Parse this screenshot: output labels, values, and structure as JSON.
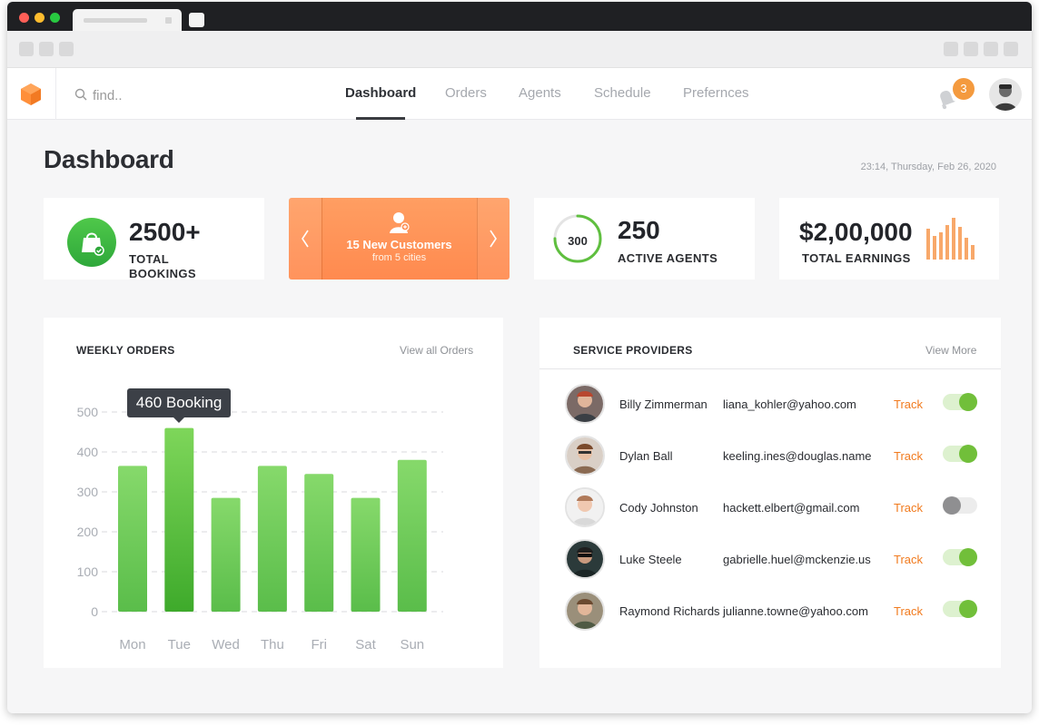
{
  "nav": {
    "search_placeholder": "find..",
    "links": [
      "Dashboard",
      "Orders",
      "Agents",
      "Schedule",
      "Prefernces"
    ],
    "active_index": 0,
    "notification_count": "3"
  },
  "page": {
    "title": "Dashboard",
    "datetime": "23:14, Thursday, Feb 26, 2020"
  },
  "stats": {
    "bookings": {
      "value": "2500+",
      "label_line1": "TOTAL",
      "label_line2": "BOOKINGS"
    },
    "promo": {
      "title": "15 New Customers",
      "subtitle": "from 5 cities"
    },
    "agents": {
      "ring_value": "300",
      "ring_fraction": 0.75,
      "value": "250",
      "label": "ACTIVE AGENTS"
    },
    "earnings": {
      "value": "$2,00,000",
      "label": "TOTAL EARNINGS"
    }
  },
  "weekly_orders": {
    "title": "WEEKLY ORDERS",
    "link": "View all Orders",
    "tooltip": "460 Booking"
  },
  "service_providers": {
    "title": "SERVICE PROVIDERS",
    "link": "View More",
    "track_label": "Track",
    "rows": [
      {
        "name": "Billy Zimmerman",
        "email": "liana_kohler@yahoo.com",
        "enabled": true
      },
      {
        "name": "Dylan Ball",
        "email": "keeling.ines@douglas.name",
        "enabled": true
      },
      {
        "name": "Cody Johnston",
        "email": "hackett.elbert@gmail.com",
        "enabled": false
      },
      {
        "name": "Luke Steele",
        "email": "gabrielle.huel@mckenzie.us",
        "enabled": true
      },
      {
        "name": "Raymond Richards",
        "email": "julianne.towne@yahoo.com",
        "enabled": true
      }
    ]
  },
  "chart_data": {
    "type": "bar",
    "title": "WEEKLY ORDERS",
    "categories": [
      "Mon",
      "Tue",
      "Wed",
      "Thu",
      "Fri",
      "Sat",
      "Sun"
    ],
    "values": [
      365,
      460,
      285,
      365,
      345,
      285,
      380
    ],
    "ylim": [
      0,
      500
    ],
    "yticks": [
      0,
      100,
      200,
      300,
      400,
      500
    ],
    "grid": true,
    "highlight_index": 1
  },
  "colors": {
    "accent_orange": "#f17a1d",
    "bar_green": "#6fcd4f",
    "bar_green_dark": "#3eaa2b",
    "toggle_on": "#71bf3a"
  }
}
